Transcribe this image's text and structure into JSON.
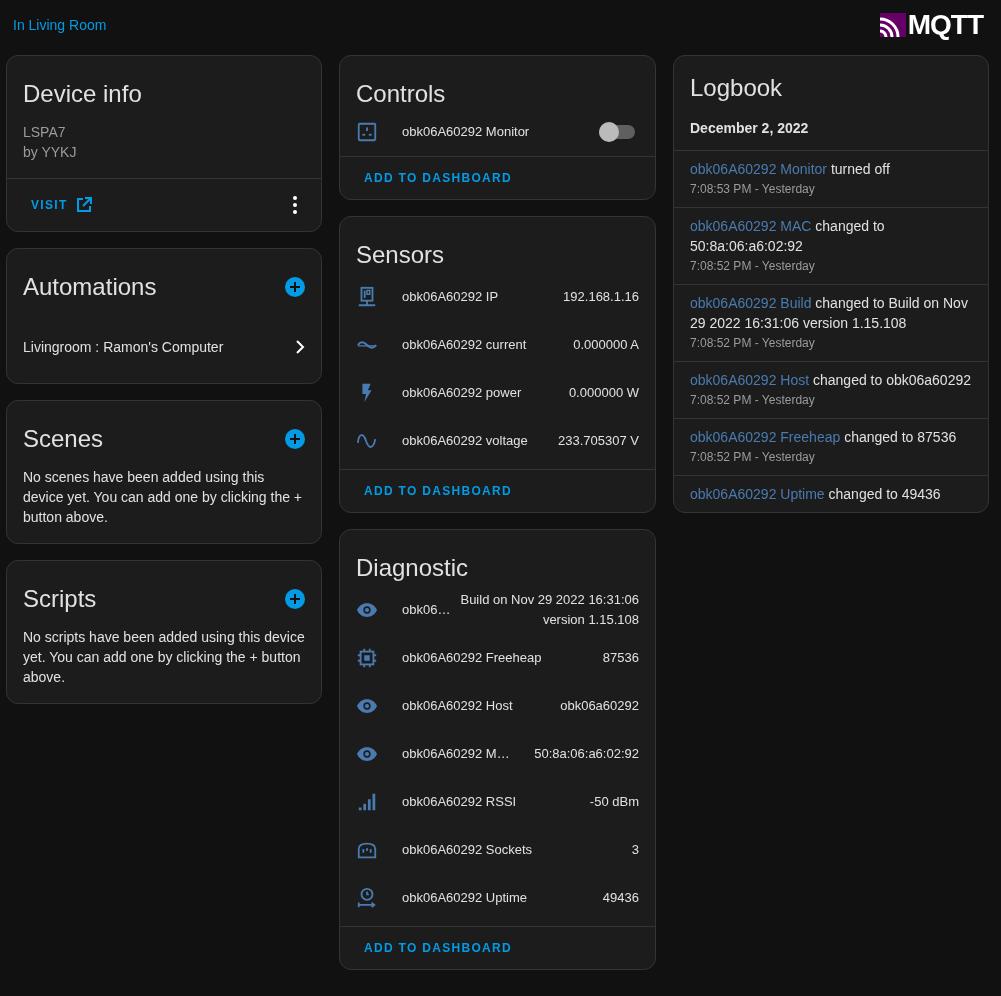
{
  "header": {
    "area_link": "In Living Room",
    "logo_text": "MQTT"
  },
  "device_info": {
    "title": "Device info",
    "model": "LSPA7",
    "manufacturer": "by YYKJ",
    "visit": "VISIT"
  },
  "automations": {
    "title": "Automations",
    "items": [
      "Livingroom : Ramon's Computer"
    ]
  },
  "scenes": {
    "title": "Scenes",
    "empty": "No scenes have been added using this device yet. You can add one by clicking the + button above."
  },
  "scripts": {
    "title": "Scripts",
    "empty": "No scripts have been added using this device yet. You can add one by clicking the + button above."
  },
  "controls": {
    "title": "Controls",
    "rows": [
      {
        "name": "obk06A60292 Monitor",
        "on": false
      }
    ],
    "action": "ADD TO DASHBOARD"
  },
  "sensors": {
    "title": "Sensors",
    "rows": [
      {
        "name": "obk06A60292 IP",
        "value": "192.168.1.16"
      },
      {
        "name": "obk06A60292 current",
        "value": "0.000000 A"
      },
      {
        "name": "obk06A60292 power",
        "value": "0.000000 W"
      },
      {
        "name": "obk06A60292 voltage",
        "value": "233.705307 V"
      }
    ],
    "action": "ADD TO DASHBOARD"
  },
  "diagnostic": {
    "title": "Diagnostic",
    "rows": [
      {
        "name": "obk06…",
        "value": "Build on Nov 29 2022 16:31:06 version 1.15.108"
      },
      {
        "name": "obk06A60292 Freeheap",
        "value": "87536"
      },
      {
        "name": "obk06A60292 Host",
        "value": "obk06a60292"
      },
      {
        "name": "obk06A60292 M…",
        "value": "50:8a:06:a6:02:92"
      },
      {
        "name": "obk06A60292 RSSI",
        "value": "-50 dBm"
      },
      {
        "name": "obk06A60292 Sockets",
        "value": "3"
      },
      {
        "name": "obk06A60292 Uptime",
        "value": "49436"
      }
    ],
    "action": "ADD TO DASHBOARD"
  },
  "logbook": {
    "title": "Logbook",
    "date": "December 2, 2022",
    "entries": [
      {
        "entity": "obk06A60292 Monitor",
        "message": "turned off",
        "time": "7:08:53 PM - Yesterday"
      },
      {
        "entity": "obk06A60292 MAC",
        "message": "changed to 50:8a:06:a6:02:92",
        "time": "7:08:52 PM - Yesterday"
      },
      {
        "entity": "obk06A60292 Build",
        "message": "changed to Build on Nov 29 2022 16:31:06 version 1.15.108",
        "time": "7:08:52 PM - Yesterday"
      },
      {
        "entity": "obk06A60292 Host",
        "message": "changed to obk06a60292",
        "time": "7:08:52 PM - Yesterday"
      },
      {
        "entity": "obk06A60292 Freeheap",
        "message": "changed to 87536",
        "time": "7:08:52 PM - Yesterday"
      },
      {
        "entity": "obk06A60292 Uptime",
        "message": "changed to 49436"
      }
    ]
  }
}
